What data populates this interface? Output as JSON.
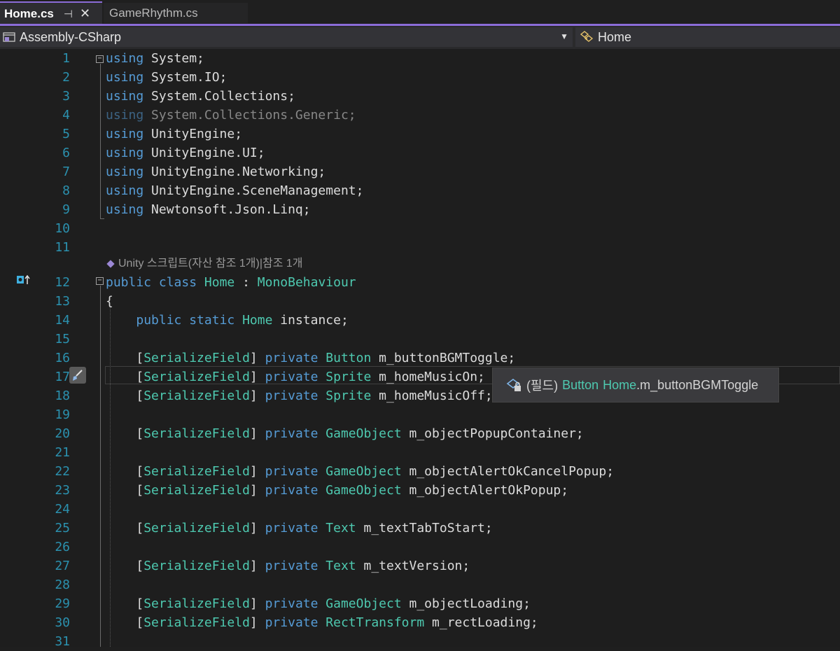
{
  "tabs": [
    {
      "label": "Home.cs",
      "active": true
    },
    {
      "label": "GameRhythm.cs",
      "active": false
    }
  ],
  "nav": {
    "project": "Assembly-CSharp",
    "class": "Home"
  },
  "codelens": "Unity 스크립트(자산 참조 1개)|참조 1개",
  "tooltip": {
    "kind": "(필드)",
    "type": "Button",
    "owner": "Home",
    "member": ".m_buttonBGMToggle"
  },
  "lines": [
    {
      "n": "1",
      "t": [
        [
          "kw",
          "using"
        ],
        [
          "id",
          " System;"
        ]
      ]
    },
    {
      "n": "2",
      "t": [
        [
          "kw",
          "using"
        ],
        [
          "id",
          " System.IO;"
        ]
      ]
    },
    {
      "n": "3",
      "t": [
        [
          "kw",
          "using"
        ],
        [
          "id",
          " System.Collections;"
        ]
      ]
    },
    {
      "n": "4",
      "t": [
        [
          "kw",
          "using"
        ],
        [
          "id",
          " System.Collections.Generic;"
        ]
      ],
      "faded": true
    },
    {
      "n": "5",
      "t": [
        [
          "kw",
          "using"
        ],
        [
          "id",
          " UnityEngine;"
        ]
      ]
    },
    {
      "n": "6",
      "t": [
        [
          "kw",
          "using"
        ],
        [
          "id",
          " UnityEngine.UI;"
        ]
      ]
    },
    {
      "n": "7",
      "t": [
        [
          "kw",
          "using"
        ],
        [
          "id",
          " UnityEngine.Networking;"
        ]
      ]
    },
    {
      "n": "8",
      "t": [
        [
          "kw",
          "using"
        ],
        [
          "id",
          " UnityEngine.SceneManagement;"
        ]
      ]
    },
    {
      "n": "9",
      "t": [
        [
          "kw",
          "using"
        ],
        [
          "id",
          " Newtonsoft.Json.Linq;"
        ]
      ]
    },
    {
      "n": "10",
      "t": []
    },
    {
      "n": "11",
      "t": []
    },
    {
      "n": "12",
      "t": [
        [
          "kw",
          "public class"
        ],
        [
          "id",
          " "
        ],
        [
          "ty",
          "Home"
        ],
        [
          "id",
          " : "
        ],
        [
          "ty",
          "MonoBehaviour"
        ]
      ]
    },
    {
      "n": "13",
      "t": [
        [
          "id",
          "{"
        ]
      ]
    },
    {
      "n": "14",
      "t": [
        [
          "id",
          "    "
        ],
        [
          "kw",
          "public static"
        ],
        [
          "id",
          " "
        ],
        [
          "ty",
          "Home"
        ],
        [
          "id",
          " instance;"
        ]
      ]
    },
    {
      "n": "15",
      "t": []
    },
    {
      "n": "16",
      "t": [
        [
          "id",
          "    ["
        ],
        [
          "ty",
          "SerializeField"
        ],
        [
          "id",
          "] "
        ],
        [
          "kw",
          "private"
        ],
        [
          "id",
          " "
        ],
        [
          "ty",
          "Button"
        ],
        [
          "id",
          " m_buttonBGMToggle;"
        ]
      ]
    },
    {
      "n": "17",
      "t": [
        [
          "id",
          "    ["
        ],
        [
          "ty",
          "SerializeField"
        ],
        [
          "id",
          "] "
        ],
        [
          "kw",
          "private"
        ],
        [
          "id",
          " "
        ],
        [
          "ty",
          "Sprite"
        ],
        [
          "id",
          " m_homeMusicOn;"
        ]
      ]
    },
    {
      "n": "18",
      "t": [
        [
          "id",
          "    ["
        ],
        [
          "ty",
          "SerializeField"
        ],
        [
          "id",
          "] "
        ],
        [
          "kw",
          "private"
        ],
        [
          "id",
          " "
        ],
        [
          "ty",
          "Sprite"
        ],
        [
          "id",
          " m_homeMusicOff;"
        ]
      ]
    },
    {
      "n": "19",
      "t": []
    },
    {
      "n": "20",
      "t": [
        [
          "id",
          "    ["
        ],
        [
          "ty",
          "SerializeField"
        ],
        [
          "id",
          "] "
        ],
        [
          "kw",
          "private"
        ],
        [
          "id",
          " "
        ],
        [
          "ty",
          "GameObject"
        ],
        [
          "id",
          " m_objectPopupContainer;"
        ]
      ]
    },
    {
      "n": "21",
      "t": []
    },
    {
      "n": "22",
      "t": [
        [
          "id",
          "    ["
        ],
        [
          "ty",
          "SerializeField"
        ],
        [
          "id",
          "] "
        ],
        [
          "kw",
          "private"
        ],
        [
          "id",
          " "
        ],
        [
          "ty",
          "GameObject"
        ],
        [
          "id",
          " m_objectAlertOkCancelPopup;"
        ]
      ]
    },
    {
      "n": "23",
      "t": [
        [
          "id",
          "    ["
        ],
        [
          "ty",
          "SerializeField"
        ],
        [
          "id",
          "] "
        ],
        [
          "kw",
          "private"
        ],
        [
          "id",
          " "
        ],
        [
          "ty",
          "GameObject"
        ],
        [
          "id",
          " m_objectAlertOkPopup;"
        ]
      ]
    },
    {
      "n": "24",
      "t": []
    },
    {
      "n": "25",
      "t": [
        [
          "id",
          "    ["
        ],
        [
          "ty",
          "SerializeField"
        ],
        [
          "id",
          "] "
        ],
        [
          "kw",
          "private"
        ],
        [
          "id",
          " "
        ],
        [
          "ty",
          "Text"
        ],
        [
          "id",
          " m_textTabToStart;"
        ]
      ]
    },
    {
      "n": "26",
      "t": []
    },
    {
      "n": "27",
      "t": [
        [
          "id",
          "    ["
        ],
        [
          "ty",
          "SerializeField"
        ],
        [
          "id",
          "] "
        ],
        [
          "kw",
          "private"
        ],
        [
          "id",
          " "
        ],
        [
          "ty",
          "Text"
        ],
        [
          "id",
          " m_textVersion;"
        ]
      ]
    },
    {
      "n": "28",
      "t": []
    },
    {
      "n": "29",
      "t": [
        [
          "id",
          "    ["
        ],
        [
          "ty",
          "SerializeField"
        ],
        [
          "id",
          "] "
        ],
        [
          "kw",
          "private"
        ],
        [
          "id",
          " "
        ],
        [
          "ty",
          "GameObject"
        ],
        [
          "id",
          " m_objectLoading;"
        ]
      ]
    },
    {
      "n": "30",
      "t": [
        [
          "id",
          "    ["
        ],
        [
          "ty",
          "SerializeField"
        ],
        [
          "id",
          "] "
        ],
        [
          "kw",
          "private"
        ],
        [
          "id",
          " "
        ],
        [
          "ty",
          "RectTransform"
        ],
        [
          "id",
          " m_rectLoading;"
        ]
      ]
    },
    {
      "n": "31",
      "t": []
    }
  ]
}
